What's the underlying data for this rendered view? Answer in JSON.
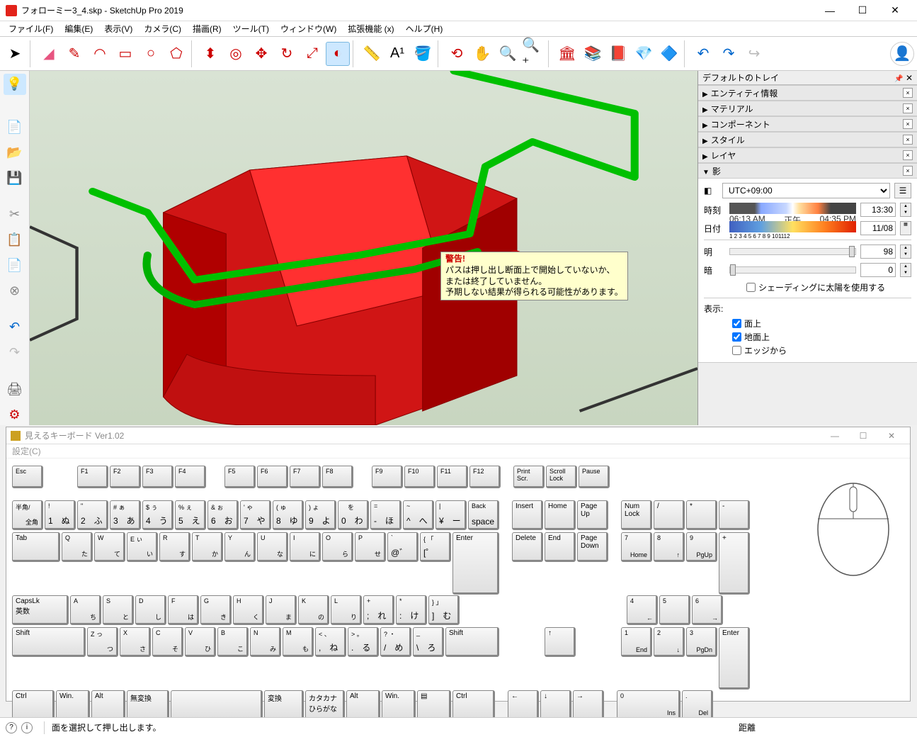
{
  "window": {
    "title": "フォローミー3_4.skp - SketchUp Pro 2019"
  },
  "menus": [
    "ファイル(F)",
    "編集(E)",
    "表示(V)",
    "カメラ(C)",
    "描画(R)",
    "ツール(T)",
    "ウィンドウ(W)",
    "拡張機能 (x)",
    "ヘルプ(H)"
  ],
  "tooltip": {
    "title": "警告!",
    "line1": "パスは押し出し断面上で開始していないか、",
    "line2": "または終了していません。",
    "line3": "予期しない結果が得られる可能性があります。"
  },
  "tray": {
    "title": "デフォルトのトレイ",
    "panels": {
      "entity": "エンティティ情報",
      "material": "マテリアル",
      "component": "コンポーネント",
      "style": "スタイル",
      "layer": "レイヤ",
      "shadow": "影"
    },
    "shadow": {
      "tz": "UTC+09:00",
      "time_label": "時刻",
      "time_lo": "06:13 AM",
      "time_mid": "正午",
      "time_hi": "04:35 PM",
      "time_value": "13:30",
      "date_label": "日付",
      "date_ticks": "1 2 3 4 5 6 7 8 9 101112",
      "date_value": "11/08",
      "light_label": "明",
      "light_value": "98",
      "dark_label": "暗",
      "dark_value": "0",
      "sun_shading": "シェーディングに太陽を使用する",
      "display_label": "表示:",
      "chk_faces": "面上",
      "chk_ground": "地面上",
      "chk_edges": "エッジから"
    }
  },
  "keyboard": {
    "title": "見えるキーボード Ver1.02",
    "menu": "設定(C)"
  },
  "status": {
    "hint": "面を選択して押し出します。",
    "distance_label": "距離"
  }
}
